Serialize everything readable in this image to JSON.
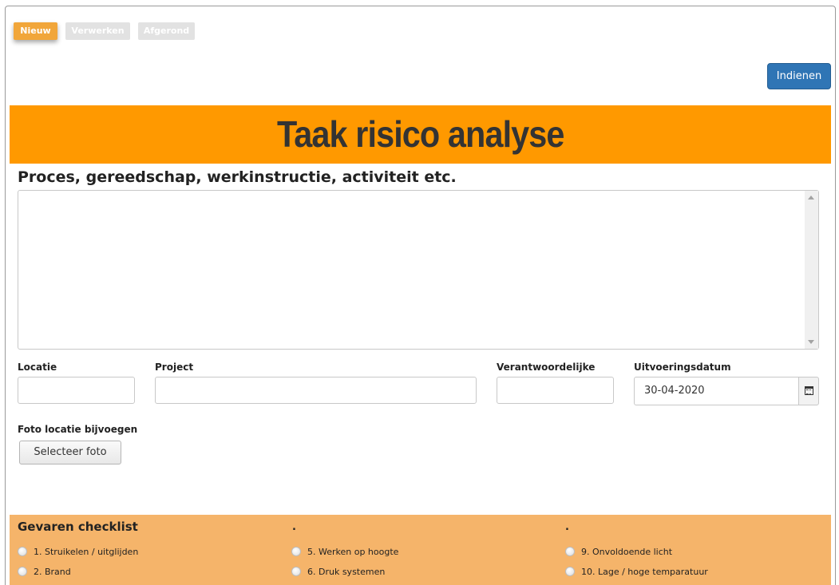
{
  "status_tabs": [
    {
      "label": "Nieuw",
      "active": true
    },
    {
      "label": "Verwerken",
      "active": false
    },
    {
      "label": "Afgerond",
      "active": false
    }
  ],
  "submit_label": "Indienen",
  "banner_title": "Taak risico analyse",
  "process_heading": "Proces, gereedschap, werkinstructie, activiteit etc.",
  "process_value": "",
  "fields": {
    "location": {
      "label": "Locatie",
      "value": ""
    },
    "project": {
      "label": "Project",
      "value": ""
    },
    "responsible": {
      "label": "Verantwoordelijke",
      "value": ""
    },
    "execution_date": {
      "label": "Uitvoeringsdatum",
      "value": "30-04-2020"
    }
  },
  "photo": {
    "label": "Foto locatie bijvoegen",
    "button": "Selecteer foto"
  },
  "checklist": {
    "title": "Gevaren checklist",
    "col2_marker": ".",
    "col3_marker": ".",
    "items": [
      "1. Struikelen / uitglijden",
      "2. Brand",
      "5. Werken op hoogte",
      "6. Druk systemen",
      "9. Onvoldoende licht",
      "10. Lage / hoge temparatuur"
    ]
  },
  "colors": {
    "active_tab": "#f1a63a",
    "inactive_tab": "#e2e2e2",
    "submit": "#2f75b5",
    "banner": "#ff9900",
    "checklist_bg": "#f5b46a"
  },
  "icons": [
    "calendar-icon",
    "scroll-up-arrow-icon",
    "scroll-down-arrow-icon"
  ]
}
